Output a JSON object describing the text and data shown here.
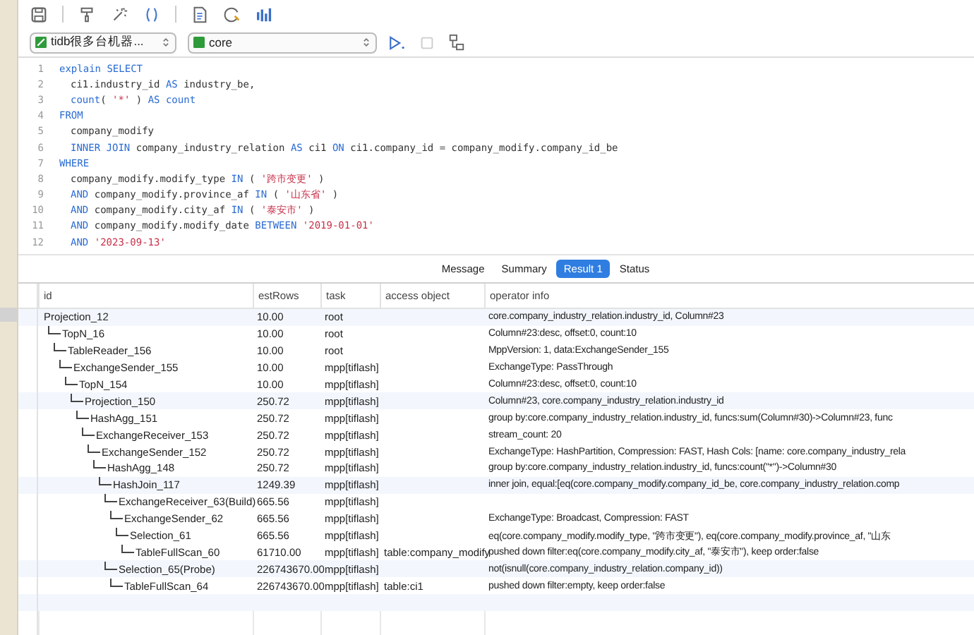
{
  "connection": {
    "value": "tidb很多台机器...",
    "database": "core"
  },
  "editor": {
    "lines": [
      {
        "number": "1",
        "indented": false,
        "tokens": [
          {
            "kind": "keyword",
            "text": "explain "
          },
          {
            "kind": "keyword",
            "text": "SELECT"
          }
        ]
      },
      {
        "number": "2",
        "indented": true,
        "tokens": [
          {
            "kind": "plain",
            "text": "ci1.industry_id "
          },
          {
            "kind": "keyword",
            "text": "AS"
          },
          {
            "kind": "plain",
            "text": " industry_be,"
          }
        ]
      },
      {
        "number": "3",
        "indented": true,
        "tokens": [
          {
            "kind": "keyword",
            "text": "count"
          },
          {
            "kind": "plain",
            "text": "( "
          },
          {
            "kind": "string",
            "text": "'*'"
          },
          {
            "kind": "plain",
            "text": " ) "
          },
          {
            "kind": "keyword",
            "text": "AS count"
          }
        ]
      },
      {
        "number": "4",
        "indented": false,
        "tokens": [
          {
            "kind": "keyword",
            "text": "FROM"
          }
        ]
      },
      {
        "number": "5",
        "indented": true,
        "tokens": [
          {
            "kind": "plain",
            "text": "company_modify"
          }
        ]
      },
      {
        "number": "6",
        "indented": true,
        "tokens": [
          {
            "kind": "keyword",
            "text": "INNER JOIN"
          },
          {
            "kind": "plain",
            "text": " company_industry_relation "
          },
          {
            "kind": "keyword",
            "text": "AS"
          },
          {
            "kind": "plain",
            "text": " ci1 "
          },
          {
            "kind": "keyword",
            "text": "ON"
          },
          {
            "kind": "plain",
            "text": " ci1.company_id = company_modify.company_id_be"
          }
        ]
      },
      {
        "number": "7",
        "indented": false,
        "tokens": [
          {
            "kind": "keyword",
            "text": "WHERE"
          }
        ]
      },
      {
        "number": "8",
        "indented": true,
        "tokens": [
          {
            "kind": "plain",
            "text": "company_modify.modify_type "
          },
          {
            "kind": "keyword",
            "text": "IN"
          },
          {
            "kind": "plain",
            "text": " ( "
          },
          {
            "kind": "string",
            "text": "'跨市变更'"
          },
          {
            "kind": "plain",
            "text": " )"
          }
        ]
      },
      {
        "number": "9",
        "indented": true,
        "tokens": [
          {
            "kind": "keyword",
            "text": "AND"
          },
          {
            "kind": "plain",
            "text": " company_modify.province_af "
          },
          {
            "kind": "keyword",
            "text": "IN"
          },
          {
            "kind": "plain",
            "text": " ( "
          },
          {
            "kind": "string",
            "text": "'山东省'"
          },
          {
            "kind": "plain",
            "text": " )"
          }
        ]
      },
      {
        "number": "10",
        "indented": true,
        "tokens": [
          {
            "kind": "keyword",
            "text": "AND"
          },
          {
            "kind": "plain",
            "text": " company_modify.city_af "
          },
          {
            "kind": "keyword",
            "text": "IN"
          },
          {
            "kind": "plain",
            "text": " ( "
          },
          {
            "kind": "string",
            "text": "'泰安市'"
          },
          {
            "kind": "plain",
            "text": " )"
          }
        ]
      },
      {
        "number": "11",
        "indented": true,
        "tokens": [
          {
            "kind": "keyword",
            "text": "AND"
          },
          {
            "kind": "plain",
            "text": " company_modify.modify_date "
          },
          {
            "kind": "keyword",
            "text": "BETWEEN "
          },
          {
            "kind": "string",
            "text": "'2019-01-01'"
          }
        ]
      },
      {
        "number": "12",
        "indented": true,
        "tokens": [
          {
            "kind": "keyword",
            "text": "AND "
          },
          {
            "kind": "string",
            "text": "'2023-09-13'"
          }
        ]
      }
    ]
  },
  "result_tabs": [
    {
      "label": "Message",
      "selected": false
    },
    {
      "label": "Summary",
      "selected": false
    },
    {
      "label": "Result 1",
      "selected": true
    },
    {
      "label": "Status",
      "selected": false
    }
  ],
  "table": {
    "columns": [
      "id",
      "estRows",
      "task",
      "access object",
      "operator info"
    ],
    "rows": [
      {
        "id": "Projection_12",
        "estRows": "10.00",
        "task": "root",
        "operator_info": "core.company_industry_relation.industry_id, Column#23",
        "children": [
          {
            "id": "TopN_16",
            "estRows": "10.00",
            "task": "root",
            "operator_info": "Column#23:desc, offset:0, count:10",
            "children": [
              {
                "id": "TableReader_156",
                "estRows": "10.00",
                "task": "root",
                "operator_info": "MppVersion: 1, data:ExchangeSender_155",
                "children": [
                  {
                    "id": "ExchangeSender_155",
                    "estRows": "10.00",
                    "task": "mpp[tiflash]",
                    "operator_info": "ExchangeType: PassThrough",
                    "children": [
                      {
                        "id": "TopN_154",
                        "estRows": "10.00",
                        "task": "mpp[tiflash]",
                        "operator_info": "Column#23:desc, offset:0, count:10",
                        "children": [
                          {
                            "id": "Projection_150",
                            "estRows": "250.72",
                            "task": "mpp[tiflash]",
                            "operator_info": "Column#23, core.company_industry_relation.industry_id",
                            "children": [
                              {
                                "id": "HashAgg_151",
                                "estRows": "250.72",
                                "task": "mpp[tiflash]",
                                "operator_info": "group by:core.company_industry_relation.industry_id, funcs:sum(Column#30)->Column#23, func",
                                "children": [
                                  {
                                    "id": "ExchangeReceiver_153",
                                    "estRows": "250.72",
                                    "task": "mpp[tiflash]",
                                    "operator_info": "stream_count: 20",
                                    "children": [
                                      {
                                        "id": "ExchangeSender_152",
                                        "estRows": "250.72",
                                        "task": "mpp[tiflash]",
                                        "operator_info": "ExchangeType: HashPartition, Compression: FAST, Hash Cols: [name: core.company_industry_rela",
                                        "children": [
                                          {
                                            "id": "HashAgg_148",
                                            "estRows": "250.72",
                                            "task": "mpp[tiflash]",
                                            "operator_info": "group by:core.company_industry_relation.industry_id, funcs:count(\"*\")->Column#30",
                                            "children": [
                                              {
                                                "id": "HashJoin_117",
                                                "estRows": "1249.39",
                                                "task": "mpp[tiflash]",
                                                "operator_info": "inner join, equal:[eq(core.company_modify.company_id_be, core.company_industry_relation.comp",
                                                "children": [
                                                  {
                                                    "id": "ExchangeReceiver_63(Build)",
                                                    "estRows": "665.56",
                                                    "task": "mpp[tiflash]",
                                                    "children": [
                                                      {
                                                        "id": "ExchangeSender_62",
                                                        "estRows": "665.56",
                                                        "task": "mpp[tiflash]",
                                                        "operator_info": "ExchangeType: Broadcast, Compression: FAST",
                                                        "children": [
                                                          {
                                                            "id": "Selection_61",
                                                            "estRows": "665.56",
                                                            "task": "mpp[tiflash]",
                                                            "operator_info": "eq(core.company_modify.modify_type, \"跨市变更\"), eq(core.company_modify.province_af, \"山东",
                                                            "children": [
                                                              {
                                                                "id": "TableFullScan_60",
                                                                "estRows": "61710.00",
                                                                "task": "mpp[tiflash]",
                                                                "access_object": "table:company_modify",
                                                                "operator_info": "pushed down filter:eq(core.company_modify.city_af, \"泰安市\"), keep order:false"
                                                              }
                                                            ]
                                                          }
                                                        ]
                                                      }
                                                    ]
                                                  },
                                                  {
                                                    "id": "Selection_65(Probe)",
                                                    "estRows": "226743670.00",
                                                    "task": "mpp[tiflash]",
                                                    "operator_info": "not(isnull(core.company_industry_relation.company_id))",
                                                    "children": [
                                                      {
                                                        "id": "TableFullScan_64",
                                                        "estRows": "226743670.00",
                                                        "task": "mpp[tiflash]",
                                                        "access_object": "table:ci1",
                                                        "operator_info": "pushed down filter:empty, keep order:false"
                                                      }
                                                    ]
                                                  }
                                                ]
                                              }
                                            ]
                                          }
                                        ]
                                      }
                                    ]
                                  }
                                ]
                              }
                            ]
                          }
                        ]
                      }
                    ]
                  }
                ]
              }
            ]
          }
        ]
      }
    ]
  }
}
